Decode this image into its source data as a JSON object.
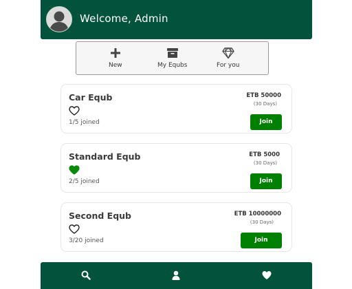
{
  "header": {
    "welcome_text": "Welcome, Admin"
  },
  "quick_actions": [
    {
      "label": "New",
      "icon": "plus-icon"
    },
    {
      "label": "My Equbs",
      "icon": "archive-box-icon"
    },
    {
      "label": "For you",
      "icon": "diamond-icon"
    }
  ],
  "equbs": [
    {
      "name": "Car Equb",
      "price": "ETB 50000",
      "duration": "(30 Days)",
      "joined": "1/5 joined",
      "favorite": false,
      "join_label": "Join"
    },
    {
      "name": "Standard Equb",
      "price": "ETB 5000",
      "duration": "(30 Days)",
      "joined": "2/5 joined",
      "favorite": true,
      "join_label": "Join"
    },
    {
      "name": "Second Equb",
      "price": "ETB 10000000",
      "duration": "(30 Days)",
      "joined": "3/20 joined",
      "favorite": false,
      "join_label": "Join"
    }
  ],
  "bottom_nav": [
    {
      "icon": "search-icon"
    },
    {
      "icon": "user-icon"
    },
    {
      "icon": "heart-icon"
    }
  ],
  "colors": {
    "header_bg": "#03523b",
    "accent_green": "#008000"
  }
}
